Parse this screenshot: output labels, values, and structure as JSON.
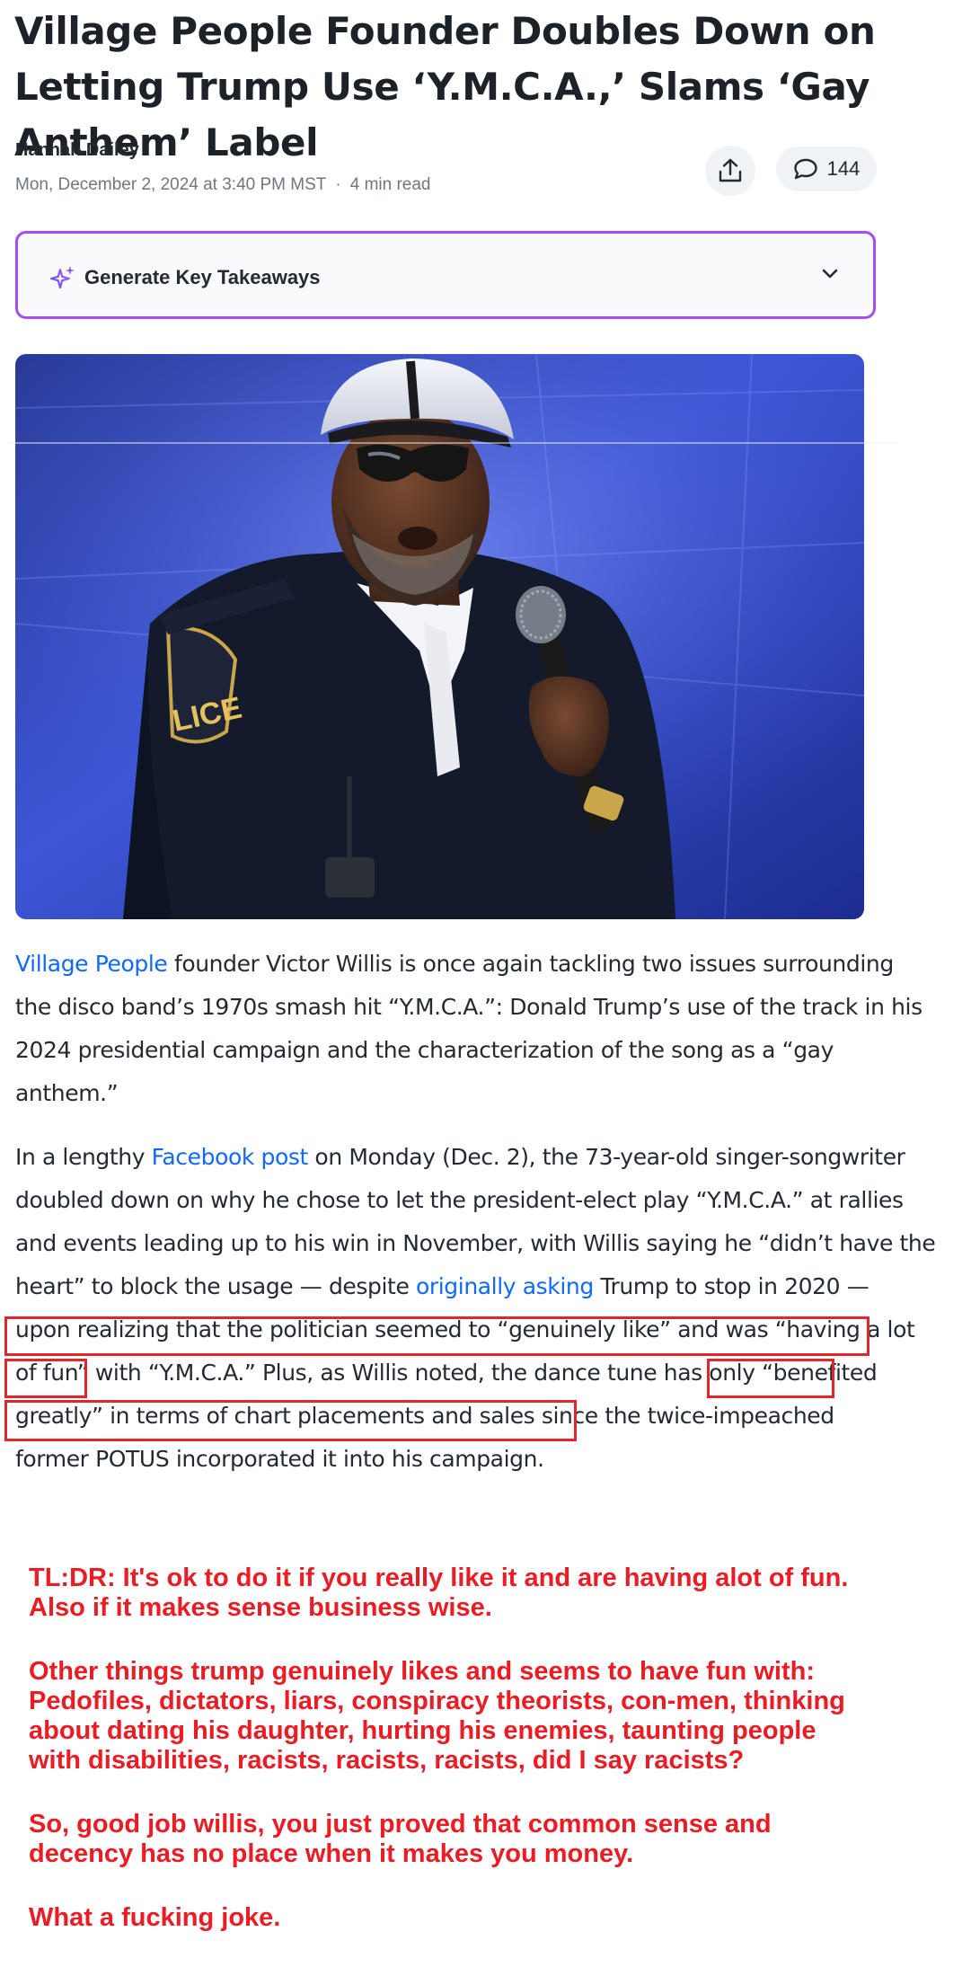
{
  "article": {
    "headline": "Village People Founder Doubles Down on Letting Trump Use ‘Y.M.C.A.,’ Slams ‘Gay Anthem’ Label",
    "author": "Hannah Dailey",
    "date": "Mon, December 2, 2024 at 3:40 PM MST",
    "read_time": "4 min read",
    "separator": "·",
    "comment_count": "144"
  },
  "takeaways": {
    "label": "Generate Key Takeaways"
  },
  "icons": {
    "share": "share-icon",
    "comment": "comment-icon",
    "sparkle": "sparkle-icon",
    "chevron": "chevron-down-icon"
  },
  "colors": {
    "link": "#0f69ff",
    "takeaways_border": "#a64cf0",
    "annotation_red": "#e1262c"
  },
  "paragraph1": {
    "l1_link": "Village People",
    "l1_rest": " founder Victor Willis is once again tackling two issues surrounding",
    "l2": "the disco band’s 1970s smash hit “Y.M.C.A.”: Donald Trump’s use of the track in his",
    "l3": "2024 presidential campaign and the characterization of the song as a “gay",
    "l4": "anthem.”"
  },
  "paragraph2": {
    "l1_pre": "In a lengthy ",
    "l1_link": "Facebook post",
    "l1_post": " on Monday (Dec. 2), the 73-year-old singer-songwriter",
    "l2": "doubled down on why he chose to let the president-elect play “Y.M.C.A.” at rallies",
    "l3": "and events leading up to his win in November, with Willis saying he “didn’t have the",
    "l4_pre": "heart” to block the usage — despite ",
    "l4_link": "originally asking",
    "l4_post": " Trump to stop in 2020 —",
    "l5": "upon realizing that the politician seemed to “genuinely like” and was “having a lot",
    "l6": "of fun” with “Y.M.C.A.” Plus, as Willis noted, the dance tune has only “benefited",
    "l7": "greatly” in terms of chart placements and sales since the twice-impeached",
    "l8": "former POTUS incorporated it into his campaign."
  },
  "annotation": {
    "p1": "TL:DR: It's ok to do it if you really like it and are having alot of fun.\nAlso if it makes sense business wise.",
    "p2": "Other things trump genuinely likes and seems to have fun with:\nPedofiles, dictators, liars, conspiracy theorists, con-men, thinking\nabout dating his daughter, hurting his enemies, taunting people\nwith disabilities, racists, racists, racists, did I say racists?",
    "p3": "So, good job willis, you just proved that common sense and\ndecency has no place when it makes you money.",
    "p4": "What a fucking joke."
  }
}
